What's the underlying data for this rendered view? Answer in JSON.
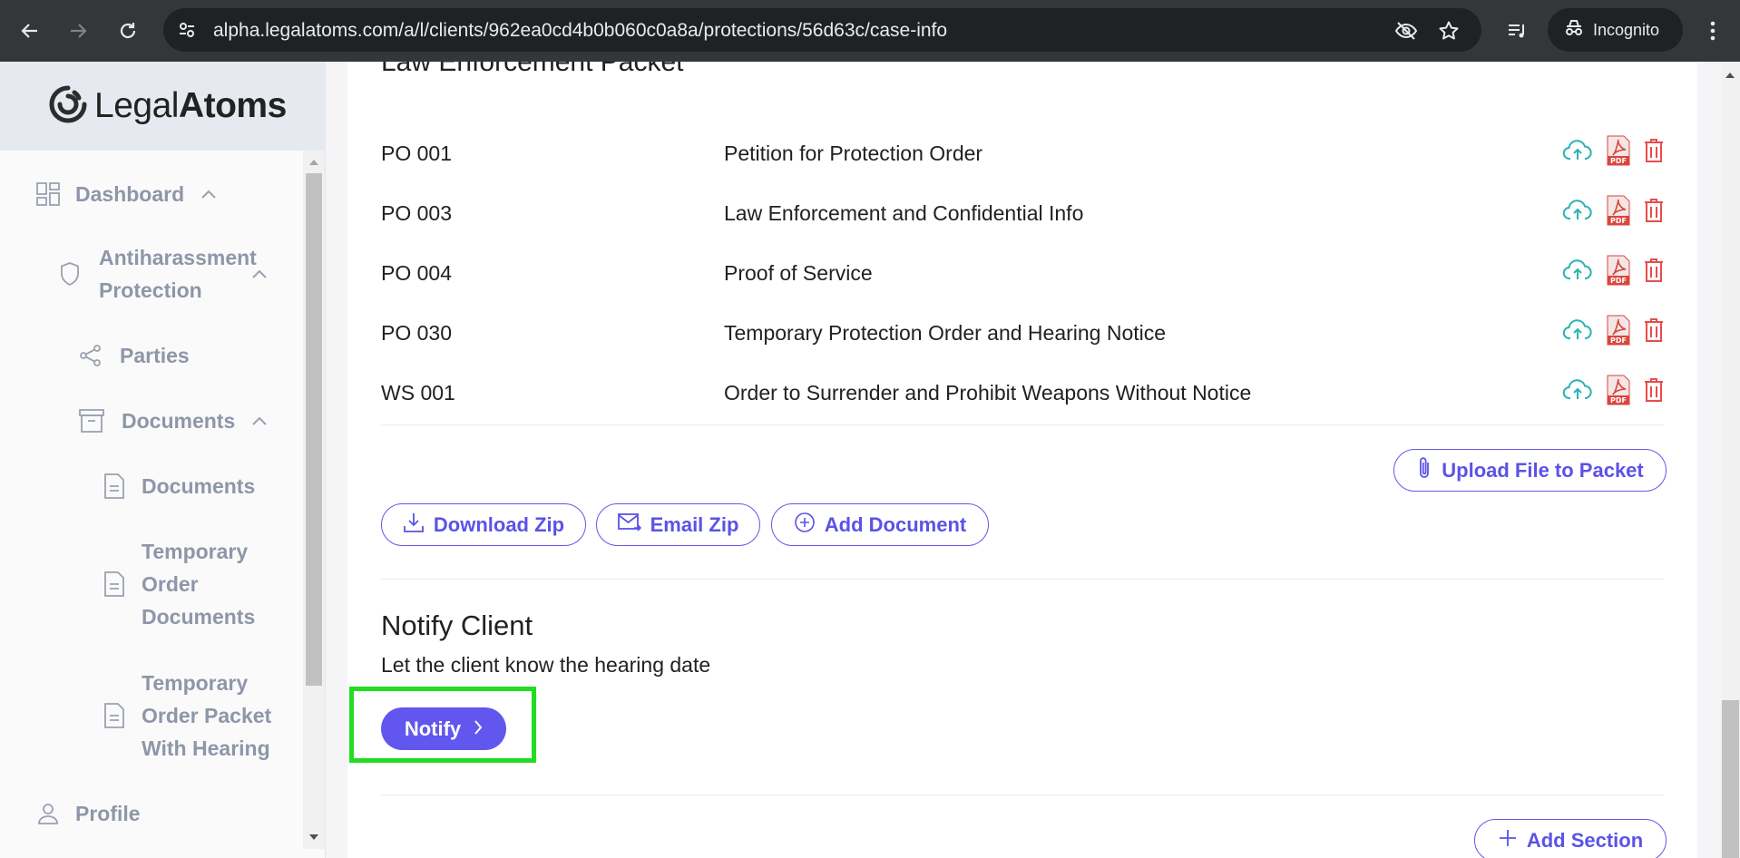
{
  "browser": {
    "url_host": "alpha.legalatoms.com",
    "url_path": "/a/l/clients/962ea0cd4b0b060c0a8a/protections/56d63c/case-info",
    "incognito_label": "Incognito"
  },
  "sidebar": {
    "logo_light": "Legal",
    "logo_bold": "Atoms",
    "items": [
      {
        "label": "Dashboard",
        "icon": "dashboard-grid-icon"
      },
      {
        "label": "Antiharassment Protection",
        "icon": "shield-icon"
      },
      {
        "label": "Parties",
        "icon": "share-icon"
      },
      {
        "label": "Documents",
        "icon": "archive-box-icon"
      },
      {
        "label": "Documents",
        "icon": "document-icon"
      },
      {
        "label": "Temporary Order Documents",
        "icon": "document-icon"
      },
      {
        "label": "Temporary Order Packet With Hearing",
        "icon": "document-icon"
      },
      {
        "label": "Profile",
        "icon": "person-icon"
      }
    ]
  },
  "packet": {
    "title": "Law Enforcement Packet",
    "documents": [
      {
        "code": "PO 001",
        "title": "Petition for Protection Order"
      },
      {
        "code": "PO 003",
        "title": "Law Enforcement and Confidential Info"
      },
      {
        "code": "PO 004",
        "title": "Proof of Service"
      },
      {
        "code": "PO 030",
        "title": "Temporary Protection Order and Hearing Notice"
      },
      {
        "code": "WS 001",
        "title": "Order to Surrender and Prohibit Weapons Without Notice"
      }
    ],
    "upload_label": "Upload File to Packet",
    "download_zip_label": "Download Zip",
    "email_zip_label": "Email Zip",
    "add_document_label": "Add Document"
  },
  "notify": {
    "title": "Notify Client",
    "subtitle": "Let the client know the hearing date",
    "button_label": "Notify"
  },
  "add_section_label": "Add Section",
  "colors": {
    "accent": "#6157ee",
    "upload_icon": "#2bb3b1",
    "pdf_icon": "#d9463e",
    "trash_icon": "#e84c4c",
    "highlight": "#22dd22"
  }
}
